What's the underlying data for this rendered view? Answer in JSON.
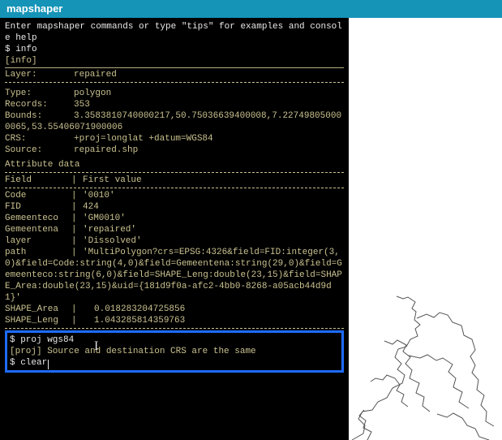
{
  "header": {
    "title": "mapshaper"
  },
  "console": {
    "help_line": "Enter mapshaper commands or type \"tips\" for examples and console help",
    "cmd_info": "$ info",
    "tag_info": "[info]",
    "layer_row": {
      "label": "Layer:",
      "value": "repaired"
    },
    "meta": {
      "type": {
        "label": "Type:",
        "value": "polygon"
      },
      "records": {
        "label": "Records:",
        "value": "353"
      },
      "bounds": {
        "label": "Bounds:",
        "value": "3.3583810740000217,50.75036639400008,7.227498050000065,53.55406071900006"
      },
      "crs": {
        "label": "CRS:",
        "value": "+proj=longlat +datum=WGS84"
      },
      "source": {
        "label": "Source:",
        "value": "repaired.shp"
      }
    },
    "attr_heading": "Attribute data",
    "attr_header": {
      "field": "Field",
      "first": "First value"
    },
    "attrs": [
      {
        "k": "Code",
        "v": "'0010'"
      },
      {
        "k": "FID",
        "v": "424"
      },
      {
        "k": "Gemeenteco",
        "v": "'GM0010'"
      },
      {
        "k": "Gemeentena",
        "v": "'repaired'"
      },
      {
        "k": "layer",
        "v": "'Dissolved'"
      },
      {
        "k": "path",
        "v": "'MultiPolygon?crs=EPSG:4326&field=FID:integer(3,0)&field=Code:string(4,0)&field=Gemeentena:string(29,0)&field=Gemeenteco:string(6,0)&field=SHAPE_Leng:double(23,15)&field=SHAPE_Area:double(23,15)&uid={181d9f0a-afc2-4bb0-8268-a05acb44d9d1}'"
      },
      {
        "k": "SHAPE_Area",
        "v": "0.018283204725856"
      },
      {
        "k": "SHAPE_Leng",
        "v": "1.043285814359763"
      }
    ],
    "highlight": {
      "cmd_proj": "$ proj wgs84",
      "proj_msg": "[proj] Source and destination CRS are the same",
      "cmd_clear_prompt": "$ ",
      "cmd_clear_text": "clear"
    }
  },
  "colors": {
    "accent": "#1594b7",
    "highlight_border": "#1e6bff",
    "console_text": "#c9c18f"
  }
}
